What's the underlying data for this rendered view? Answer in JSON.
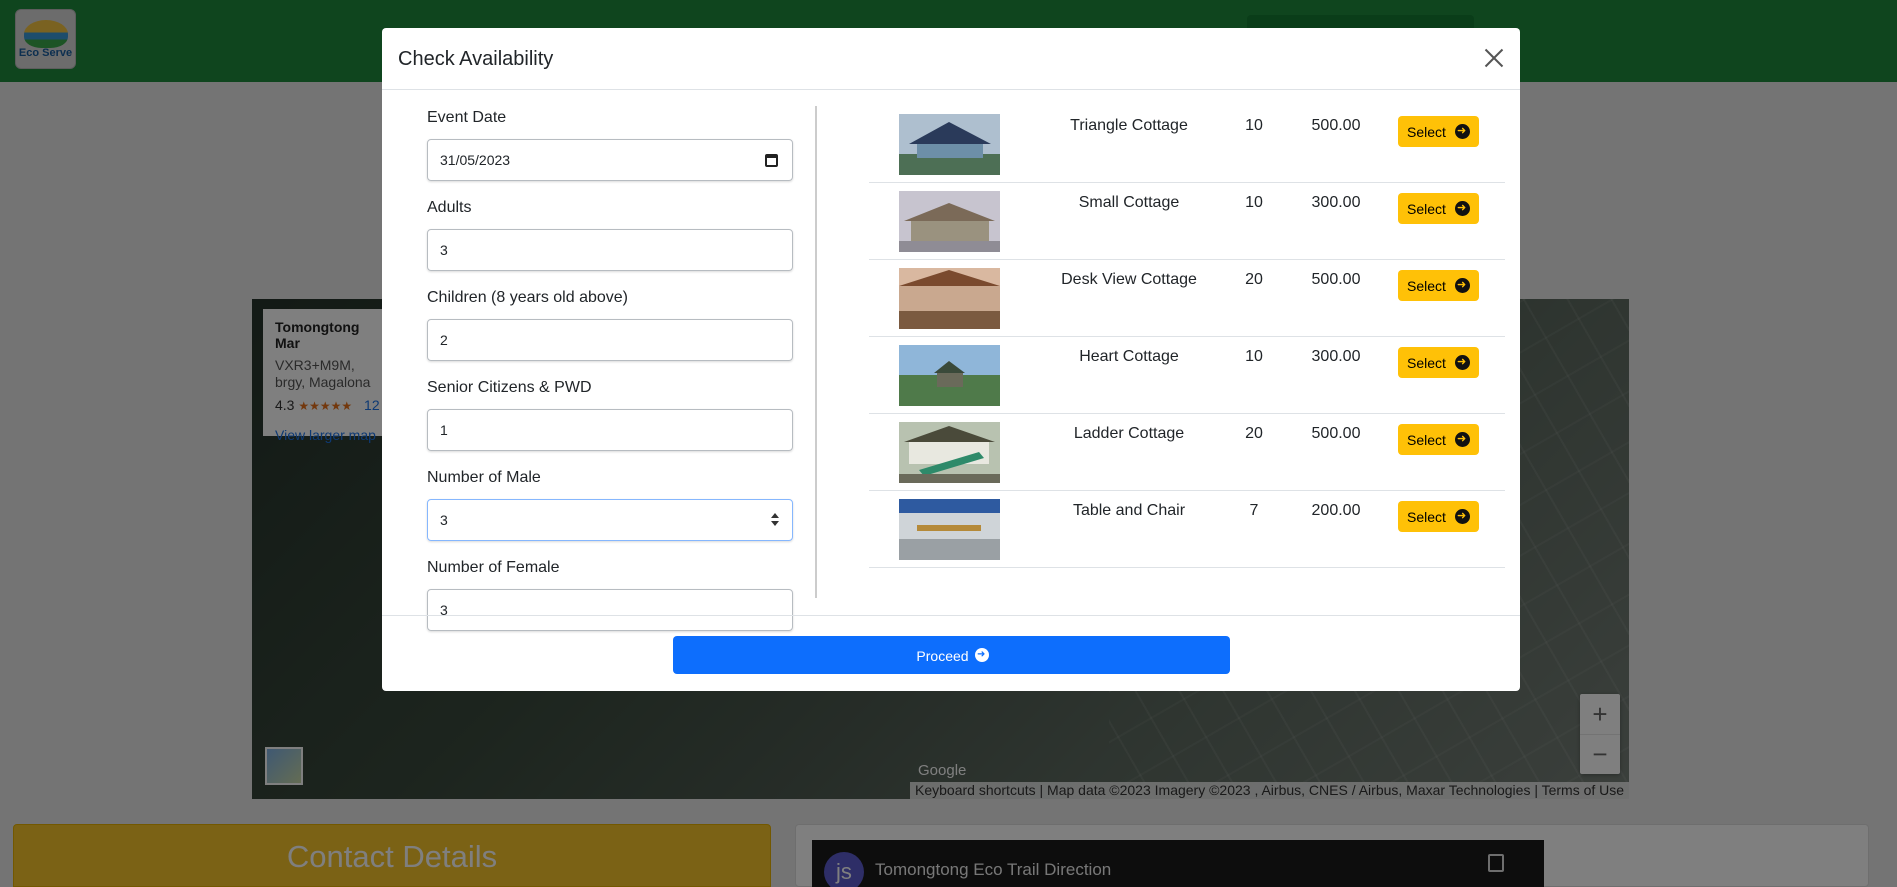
{
  "brand": {
    "logo_text": "Eco Serve"
  },
  "map": {
    "place_name": "Tomongtong Mar",
    "place_address": "VXR3+M9M, brgy, Magalona",
    "rating": "4.3",
    "rating_stars": "★★★★★",
    "rating_count": "12",
    "view_larger": "View larger map",
    "google_label": "Google",
    "footer": "Keyboard shortcuts | Map data ©2023 Imagery ©2023 , Airbus, CNES / Airbus, Maxar Technologies | Terms of Use",
    "zoom_in": "+",
    "zoom_out": "−"
  },
  "contact": {
    "title": "Contact Details"
  },
  "video": {
    "avatar": "js",
    "title": "Tomongtong Eco Trail Direction"
  },
  "modal": {
    "title": "Check Availability",
    "fields": {
      "event_date": {
        "label": "Event Date",
        "value": "31/05/2023"
      },
      "adults": {
        "label": "Adults",
        "value": "3"
      },
      "children": {
        "label": "Children (8 years old above)",
        "value": "2"
      },
      "seniors": {
        "label": "Senior Citizens & PWD",
        "value": "1"
      },
      "male": {
        "label": "Number of Male",
        "value": "3"
      },
      "female": {
        "label": "Number of Female",
        "value": "3"
      }
    },
    "select_label": "Select",
    "cottages": [
      {
        "name": "Triangle Cottage",
        "capacity": "10",
        "price": "500.00"
      },
      {
        "name": "Small Cottage",
        "capacity": "10",
        "price": "300.00"
      },
      {
        "name": "Desk View Cottage",
        "capacity": "20",
        "price": "500.00"
      },
      {
        "name": "Heart Cottage",
        "capacity": "10",
        "price": "300.00"
      },
      {
        "name": "Ladder Cottage",
        "capacity": "20",
        "price": "500.00"
      },
      {
        "name": "Table and Chair",
        "capacity": "7",
        "price": "200.00"
      }
    ],
    "proceed_label": "Proceed"
  },
  "colors": {
    "header_green": "#1e8a3c",
    "select_yellow": "#ffc107",
    "proceed_blue": "#0d6efd",
    "contact_yellow": "#f7c52b"
  }
}
